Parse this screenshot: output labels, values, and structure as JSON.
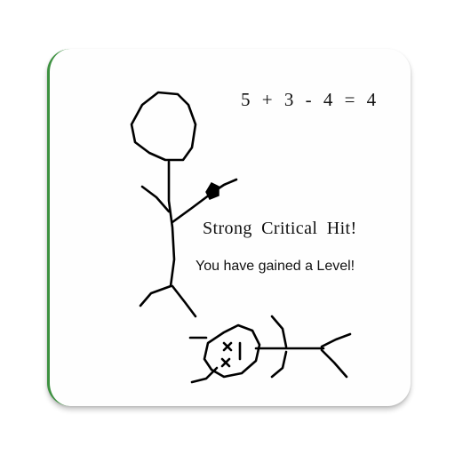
{
  "app_icon": {
    "equation": "5 + 3 - 4 = 4",
    "message_primary": "Strong Critical Hit!",
    "message_secondary": "You have gained a Level!",
    "border_accent_color": "#3d9140",
    "stroke_color": "#000000"
  }
}
